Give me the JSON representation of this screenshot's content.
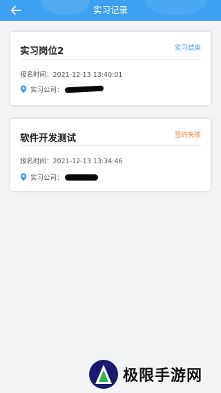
{
  "header": {
    "title": "实习记录",
    "back_icon": "arrow-left-icon",
    "color": "#3da0f0"
  },
  "records": [
    {
      "position": "实习岗位2",
      "status": "实习结束",
      "status_color": "#3f9ae0",
      "time_label": "报名时间：",
      "time_value": "2021-12-13 13:40:01",
      "company_label": "实习公司："
    },
    {
      "position": "软件开发测试",
      "status": "签约失败",
      "status_color": "#e08a3a",
      "time_label": "报名时间：",
      "time_value": "2021-12-13 13:34:46",
      "company_label": "实习公司："
    }
  ],
  "watermark": {
    "text": "极限手游网"
  }
}
